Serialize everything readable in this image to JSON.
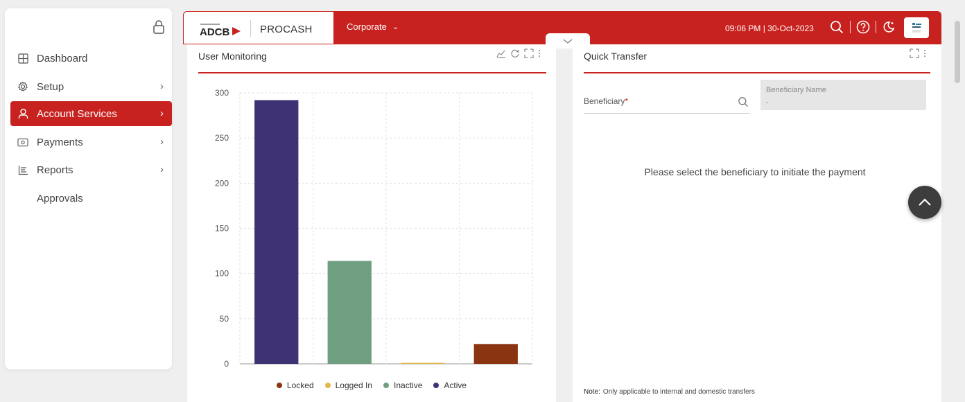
{
  "sidebar": {
    "items": [
      {
        "label": "Dashboard",
        "icon": "dashboard-icon",
        "has_chevron": false,
        "active": false
      },
      {
        "label": "Setup",
        "icon": "gear-icon",
        "has_chevron": true,
        "active": false
      },
      {
        "label": "Account Services",
        "icon": "user-icon",
        "has_chevron": true,
        "active": true
      },
      {
        "label": "Payments",
        "icon": "payments-icon",
        "has_chevron": true,
        "active": false
      },
      {
        "label": "Reports",
        "icon": "reports-icon",
        "has_chevron": true,
        "active": false
      },
      {
        "label": "Approvals",
        "icon": "",
        "has_chevron": false,
        "active": false
      }
    ]
  },
  "header": {
    "logo_text": "ADCB",
    "product": "PROCASH",
    "entity": "Corporate",
    "datetime": "09:06 PM | 30-Oct-2023",
    "accent": "#c7221f"
  },
  "user_monitoring": {
    "title": "User Monitoring"
  },
  "quick_transfer": {
    "title": "Quick Transfer",
    "beneficiary_label": "Beneficiary",
    "required_mark": "*",
    "beneficiary_name_label": "Beneficiary Name",
    "beneficiary_name_value": "-",
    "empty_message": "Please select the beneficiary to initiate the payment",
    "note_label": "Note:",
    "note_text": "Only applicable to internal and domestic transfers"
  },
  "chart_data": {
    "type": "bar",
    "categories": [
      "Active",
      "Inactive",
      "Logged In",
      "Locked"
    ],
    "values": [
      292,
      114,
      1,
      22
    ],
    "colors": [
      "#3e3275",
      "#6f9f80",
      "#e3b84a",
      "#8a3412"
    ],
    "legend": [
      {
        "label": "Locked",
        "color": "#8a3412"
      },
      {
        "label": "Logged In",
        "color": "#e3b84a"
      },
      {
        "label": "Inactive",
        "color": "#6f9f80"
      },
      {
        "label": "Active",
        "color": "#3e3275"
      }
    ],
    "yticks": [
      0,
      50,
      100,
      150,
      200,
      250,
      300
    ],
    "ylim": [
      0,
      300
    ],
    "grid": true,
    "legend_position": "bottom"
  }
}
